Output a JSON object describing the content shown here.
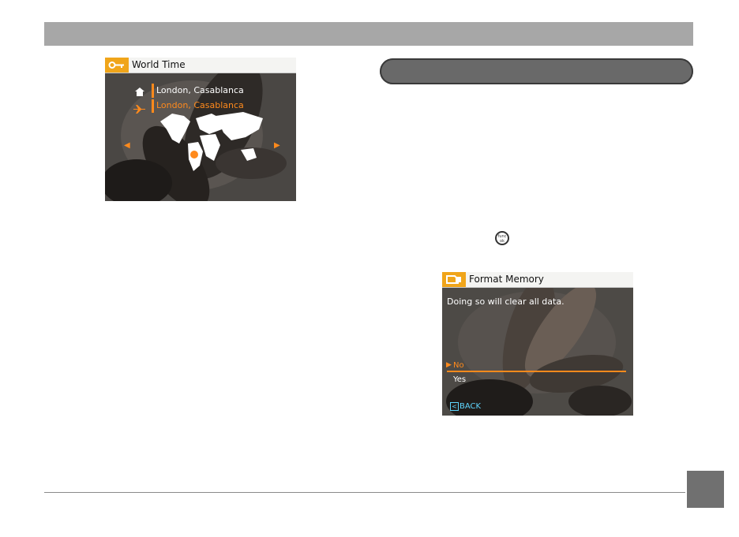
{
  "world_time": {
    "title": "World Time",
    "home_city": "London, Casablanca",
    "destination_city": "London, Casablanca"
  },
  "format_memory": {
    "title": "Format Memory",
    "message": "Doing so will clear all data.",
    "option_no": "No",
    "option_yes": "Yes",
    "back_label": "BACK"
  },
  "func_button": {
    "line1": "func",
    "line2": "ok"
  },
  "icons": [
    "key-icon",
    "home-icon",
    "plane-icon",
    "left-arrow-icon",
    "right-arrow-icon",
    "memory-icon",
    "back-icon"
  ],
  "colors": {
    "accent": "#ff8a1c",
    "title_icon_bg": "#f0a51a",
    "header_bar": "#a7a7a7",
    "section_bar": "#696969",
    "page_box": "#707070"
  }
}
